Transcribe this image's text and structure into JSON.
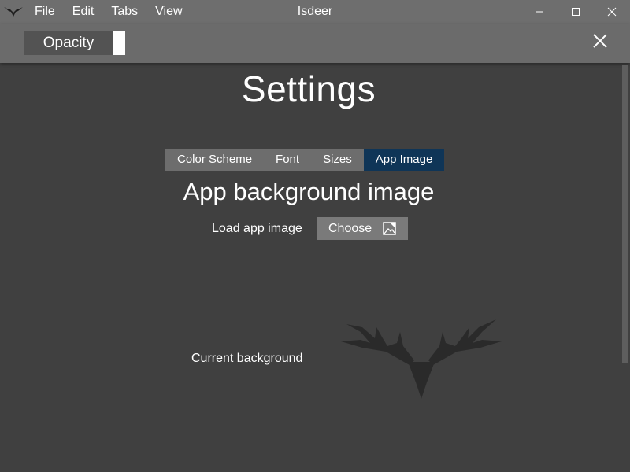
{
  "window": {
    "title": "Isdeer",
    "menu": [
      "File",
      "Edit",
      "Tabs",
      "View"
    ]
  },
  "toolbar": {
    "opacity_label": "Opacity",
    "opacity_color": "#ffffff"
  },
  "settings": {
    "title": "Settings",
    "tabs": [
      {
        "label": "Color Scheme",
        "active": false
      },
      {
        "label": "Font",
        "active": false
      },
      {
        "label": "Sizes",
        "active": false
      },
      {
        "label": "App Image",
        "active": true
      }
    ],
    "section_heading": "App background image",
    "load_label": "Load app image",
    "choose_label": "Choose",
    "current_label": "Current background"
  },
  "colors": {
    "background": "#404040",
    "titlebar": "#6e6e6e",
    "active_tab": "#0f3557",
    "tab": "#6d6d6d",
    "deer": "#2a2a2a"
  },
  "icons": {
    "app": "deer-antlers-icon",
    "minimize": "minimize-icon",
    "maximize": "maximize-icon",
    "close": "close-icon",
    "choose": "image-file-icon"
  }
}
